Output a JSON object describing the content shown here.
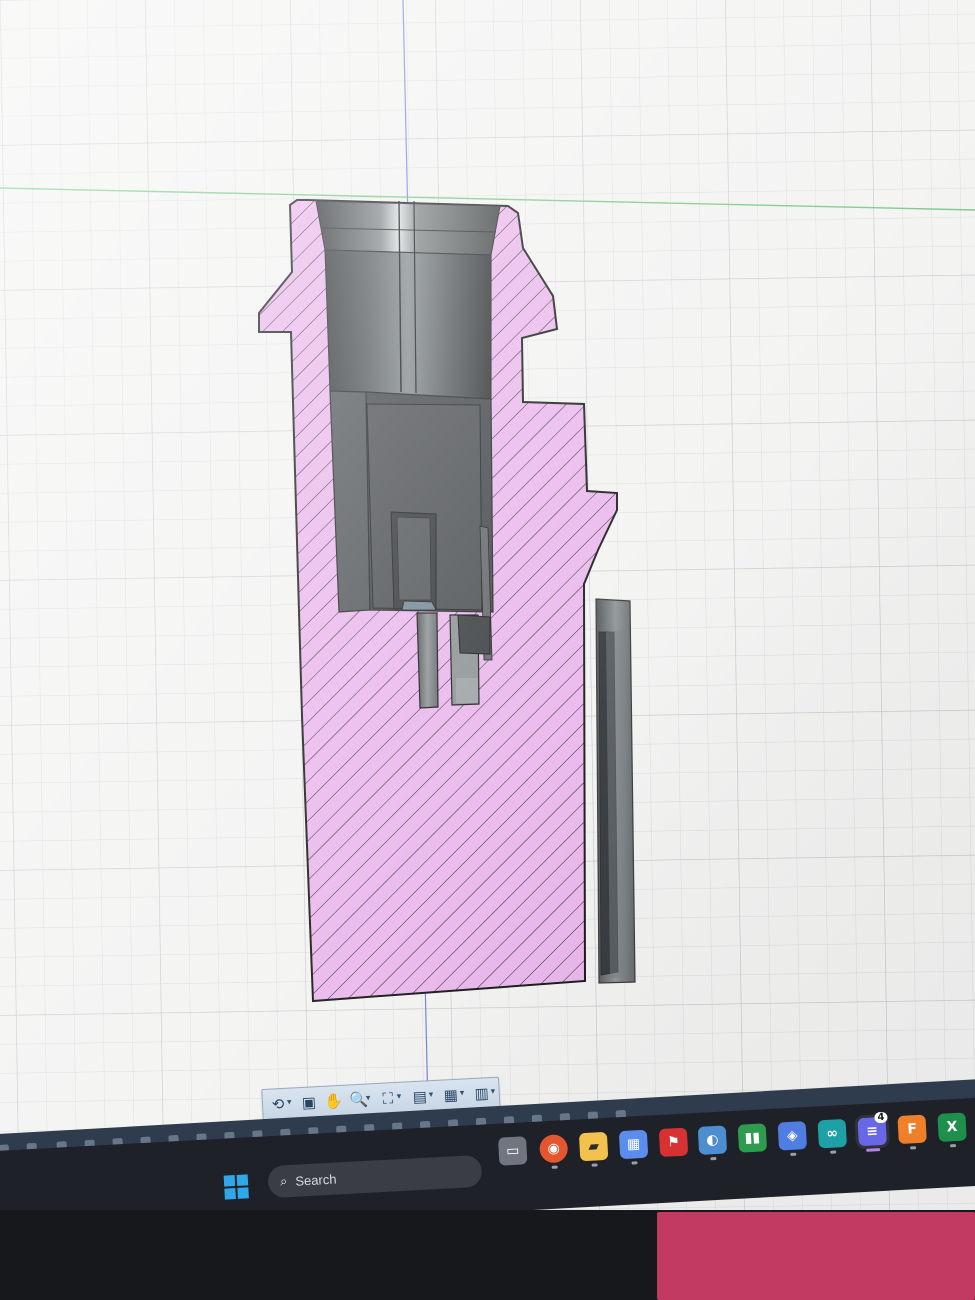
{
  "app": {
    "name": "CAD section analysis view"
  },
  "canvas": {
    "background": "#f2f2f1",
    "grid_minor": "#d8dadc",
    "grid_major": "#c4c7ca",
    "axis_blue": "#6c7fd6",
    "axis_green": "#71c67c",
    "section_fill": "#e9b5eb",
    "hatch_color": "#1c1c1c",
    "body_shadow": "#3f4142",
    "body_mid": "#727678",
    "body_light": "#d0d4d6"
  },
  "nav_toolbar": {
    "tools": [
      {
        "name": "orbit-icon",
        "glyph": "⟲",
        "dropdown": true
      },
      {
        "name": "look-at-icon",
        "glyph": "▣",
        "dropdown": false
      },
      {
        "name": "pan-icon",
        "glyph": "✋",
        "dropdown": false
      },
      {
        "name": "zoom-icon",
        "glyph": "🔍",
        "dropdown": true
      },
      {
        "name": "fit-icon",
        "glyph": "⛶",
        "dropdown": true
      },
      {
        "name": "display-settings-icon",
        "glyph": "▤",
        "dropdown": true
      },
      {
        "name": "grid-icon",
        "glyph": "▦",
        "dropdown": true
      },
      {
        "name": "viewports-icon",
        "glyph": "▥",
        "dropdown": true
      }
    ]
  },
  "timeline": {
    "background": "#2f3c4d",
    "icons": [
      "feature-icon",
      "feature-icon",
      "feature-icon",
      "feature-icon",
      "feature-icon",
      "feature-icon",
      "feature-icon",
      "feature-icon",
      "feature-icon",
      "feature-icon",
      "feature-icon",
      "feature-icon",
      "feature-icon",
      "feature-icon",
      "feature-icon",
      "feature-icon",
      "feature-icon",
      "feature-icon",
      "feature-icon",
      "feature-icon",
      "feature-icon",
      "feature-icon",
      "feature-icon",
      "feature-icon",
      "feature-icon",
      "feature-icon",
      "feature-icon",
      "feature-icon"
    ]
  },
  "taskbar": {
    "search_label": "Search",
    "apps": [
      {
        "name": "task-view-icon",
        "color": "#9aa0aa",
        "text": "▭"
      },
      {
        "name": "chrome-icon",
        "color": "#e4572e",
        "text": "◉"
      },
      {
        "name": "file-explorer-icon",
        "color": "#f2c14e",
        "text": "▰"
      },
      {
        "name": "calculator-icon",
        "color": "#5b8def",
        "text": "▦"
      },
      {
        "name": "corsair-icon",
        "color": "#d73131",
        "text": "⚑"
      },
      {
        "name": "steam-icon",
        "color": "#4d8ed1",
        "text": "◐"
      },
      {
        "name": "spreadsheet-app-icon",
        "color": "#2e9c4f",
        "text": "▮▮"
      },
      {
        "name": "controller-icon",
        "color": "#4f7de1",
        "text": "◈"
      },
      {
        "name": "arduino-icon",
        "color": "#1da0a6",
        "text": "∞"
      },
      {
        "name": "chat-app-icon",
        "color": "#6867e6",
        "text": "≡",
        "badge": "4"
      },
      {
        "name": "fusion-icon",
        "color": "#f07f2a",
        "text": "F"
      },
      {
        "name": "excel-icon",
        "color": "#1f8f4d",
        "text": "X"
      }
    ]
  }
}
